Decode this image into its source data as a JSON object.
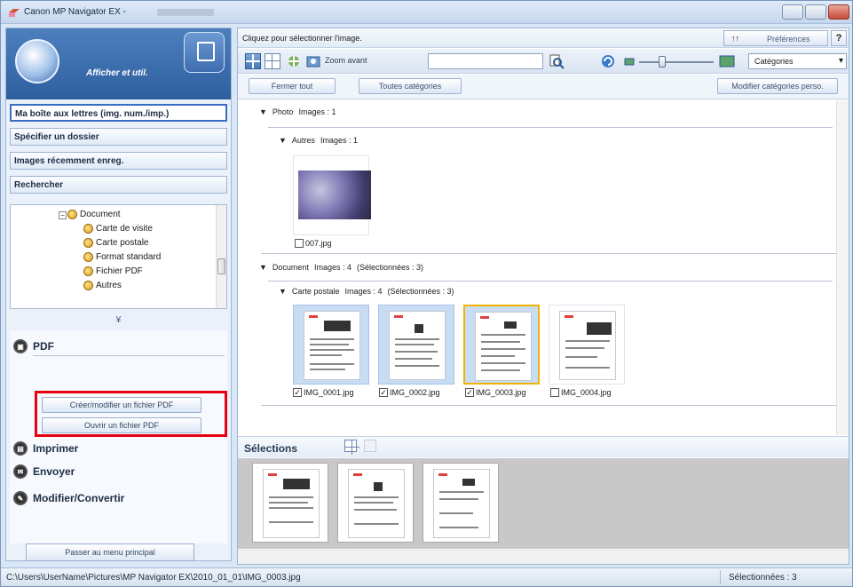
{
  "window": {
    "title": "Canon MP Navigator EX -"
  },
  "left": {
    "header_title": "Afficher et util.",
    "nav": [
      {
        "label": "Ma boîte aux lettres (img. num./imp.)"
      },
      {
        "label": "Spécifier un dossier"
      },
      {
        "label": "Images récemment enreg."
      },
      {
        "label": "Rechercher"
      }
    ],
    "tree": [
      {
        "label": "Document"
      },
      {
        "label": "Carte de visite"
      },
      {
        "label": "Carte postale"
      },
      {
        "label": "Format standard"
      },
      {
        "label": "Fichier PDF"
      },
      {
        "label": "Autres"
      }
    ],
    "splitter": "¥",
    "pdf_label": "PDF",
    "pdf_create": "Créer/modifier un fichier PDF",
    "pdf_open": "Ouvrir un fichier PDF",
    "print_label": "Imprimer",
    "send_label": "Envoyer",
    "convert_label": "Modifier/Convertir",
    "main_menu": "Passer au menu principal"
  },
  "right": {
    "hint": "Cliquez pour sélectionner l'image.",
    "preferences": "Préférences",
    "help": "?",
    "zoom_in": "Zoom avant",
    "search_value": "",
    "category_select": "Catégories",
    "close_all": "Fermer tout",
    "all_categories": "Toutes catégories",
    "modify_categories": "Modifier catégories perso.",
    "groups": {
      "photo": {
        "name": "Photo",
        "images": "Images : 1"
      },
      "autres": {
        "name": "Autres",
        "images": "Images : 1"
      },
      "document": {
        "name": "Document",
        "images": "Images : 4",
        "selected": "(Sélectionnées : 3)"
      },
      "carte": {
        "name": "Carte postale",
        "images": "Images : 4",
        "selected": "(Sélectionnées : 3)"
      }
    },
    "photo_file": "007.jpg",
    "docs": [
      {
        "file": "IMG_0001.jpg",
        "checked": "✓"
      },
      {
        "file": "IMG_0002.jpg",
        "checked": "✓"
      },
      {
        "file": "IMG_0003.jpg",
        "checked": "✓"
      },
      {
        "file": "IMG_0004.jpg",
        "checked": ""
      }
    ],
    "selections_label": "Sélections"
  },
  "status": {
    "path": "C:\\Users\\UserName\\Pictures\\MP Navigator EX\\2010_01_01\\IMG_0003.jpg",
    "selected_count": "Sélectionnées : 3"
  },
  "colors": {
    "highlight_red": "#e60012",
    "current_frame": "#f2b400",
    "accent_blue": "#2e5e9e"
  }
}
